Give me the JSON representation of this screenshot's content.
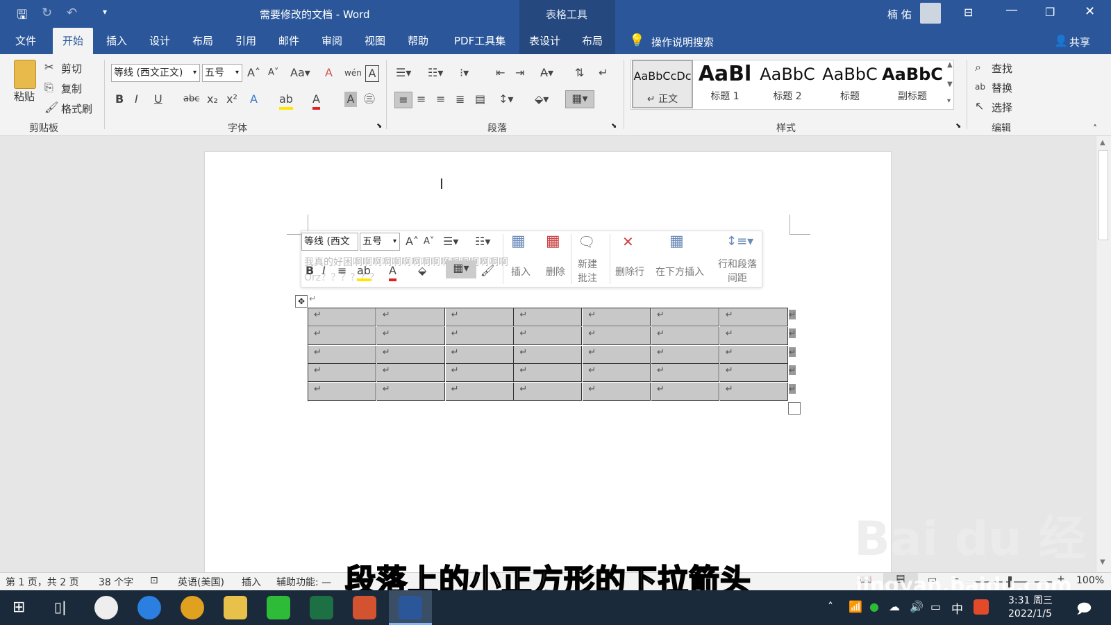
{
  "window": {
    "title": "需要修改的文档  -  Word",
    "context_tab_group": "表格工具",
    "user": "楠 佑"
  },
  "tabs": [
    "文件",
    "开始",
    "插入",
    "设计",
    "布局",
    "引用",
    "邮件",
    "审阅",
    "视图",
    "帮助",
    "PDF工具集",
    "表设计",
    "布局"
  ],
  "tell_me": "操作说明搜索",
  "share": "共享",
  "clipboard": {
    "paste": "粘贴",
    "cut": "剪切",
    "copy": "复制",
    "format_painter": "格式刷",
    "label": "剪贴板"
  },
  "font": {
    "name": "等线 (西文正文)",
    "size": "五号",
    "label": "字体"
  },
  "paragraph": {
    "label": "段落"
  },
  "styles": {
    "items": [
      {
        "preview": "AaBbCcDc",
        "name": "↵ 正文"
      },
      {
        "preview": "AaBl",
        "name": "标题 1"
      },
      {
        "preview": "AaBbC",
        "name": "标题 2"
      },
      {
        "preview": "AaBbC",
        "name": "标题"
      },
      {
        "preview": "AaBbC",
        "name": "副标题"
      }
    ],
    "label": "样式"
  },
  "editing": {
    "find": "查找",
    "replace": "替换",
    "select": "选择",
    "label": "编辑"
  },
  "mini_toolbar": {
    "font": "等线 (西文",
    "size": "五号",
    "insert": "插入",
    "delete": "删除",
    "new_comment": "新建批注",
    "delete_row": "删除行",
    "insert_below": "在下方插入",
    "spacing": "行和段落间距",
    "ghost_text": "我真的好困啊啊啊啊啊啊啊啊啊啊啊啊啊啊啊啊",
    "ghost_text2": "Orz？？？？？？"
  },
  "table": {
    "rows": 5,
    "cols": 7,
    "cell_mark": "↵"
  },
  "status": {
    "page": "第 1 页，共 2 页",
    "words": "38 个字",
    "lang": "英语(美国)",
    "mode": "插入",
    "accessibility": "辅助功能: —",
    "zoom": "100%"
  },
  "caption": "段落上的小正方形的下拉箭头",
  "watermark": {
    "brand": "Bai du 经验",
    "url": "jingyan.baidu.com"
  },
  "clock": {
    "time": "3:31 周三",
    "date": "2022/1/5"
  },
  "tray": {
    "ime": "中"
  }
}
